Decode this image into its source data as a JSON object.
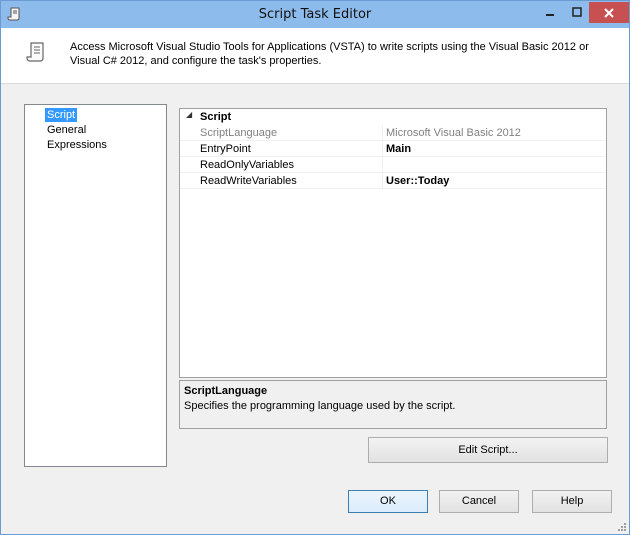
{
  "window": {
    "title": "Script Task Editor",
    "icons": {
      "app": "script-scroll-icon",
      "minimize": "minimize-icon",
      "maximize": "maximize-icon",
      "close": "close-icon"
    },
    "colors": {
      "titlebar": "#8dbbeb",
      "close": "#c75050",
      "selection": "#3399ff"
    }
  },
  "header": {
    "icon": "script-scroll-icon",
    "description": "Access Microsoft Visual Studio Tools for Applications (VSTA) to write scripts using the Visual Basic 2012 or Visual C# 2012, and configure the task's properties."
  },
  "nav": {
    "items": [
      {
        "label": "Script",
        "selected": true
      },
      {
        "label": "General",
        "selected": false
      },
      {
        "label": "Expressions",
        "selected": false
      }
    ]
  },
  "grid": {
    "category": {
      "label": "Script",
      "expanded": true,
      "icon": "collapse-triangle-icon"
    },
    "rows": [
      {
        "name": "ScriptLanguage",
        "value": "Microsoft Visual Basic 2012",
        "readonly": true,
        "bold": false
      },
      {
        "name": "EntryPoint",
        "value": "Main",
        "readonly": false,
        "bold": true
      },
      {
        "name": "ReadOnlyVariables",
        "value": "",
        "readonly": false,
        "bold": false
      },
      {
        "name": "ReadWriteVariables",
        "value": "User::Today",
        "readonly": false,
        "bold": true
      }
    ]
  },
  "description_panel": {
    "title": "ScriptLanguage",
    "text": "Specifies the programming language used by the script."
  },
  "buttons": {
    "edit_script": "Edit Script...",
    "ok": "OK",
    "cancel": "Cancel",
    "help": "Help"
  }
}
